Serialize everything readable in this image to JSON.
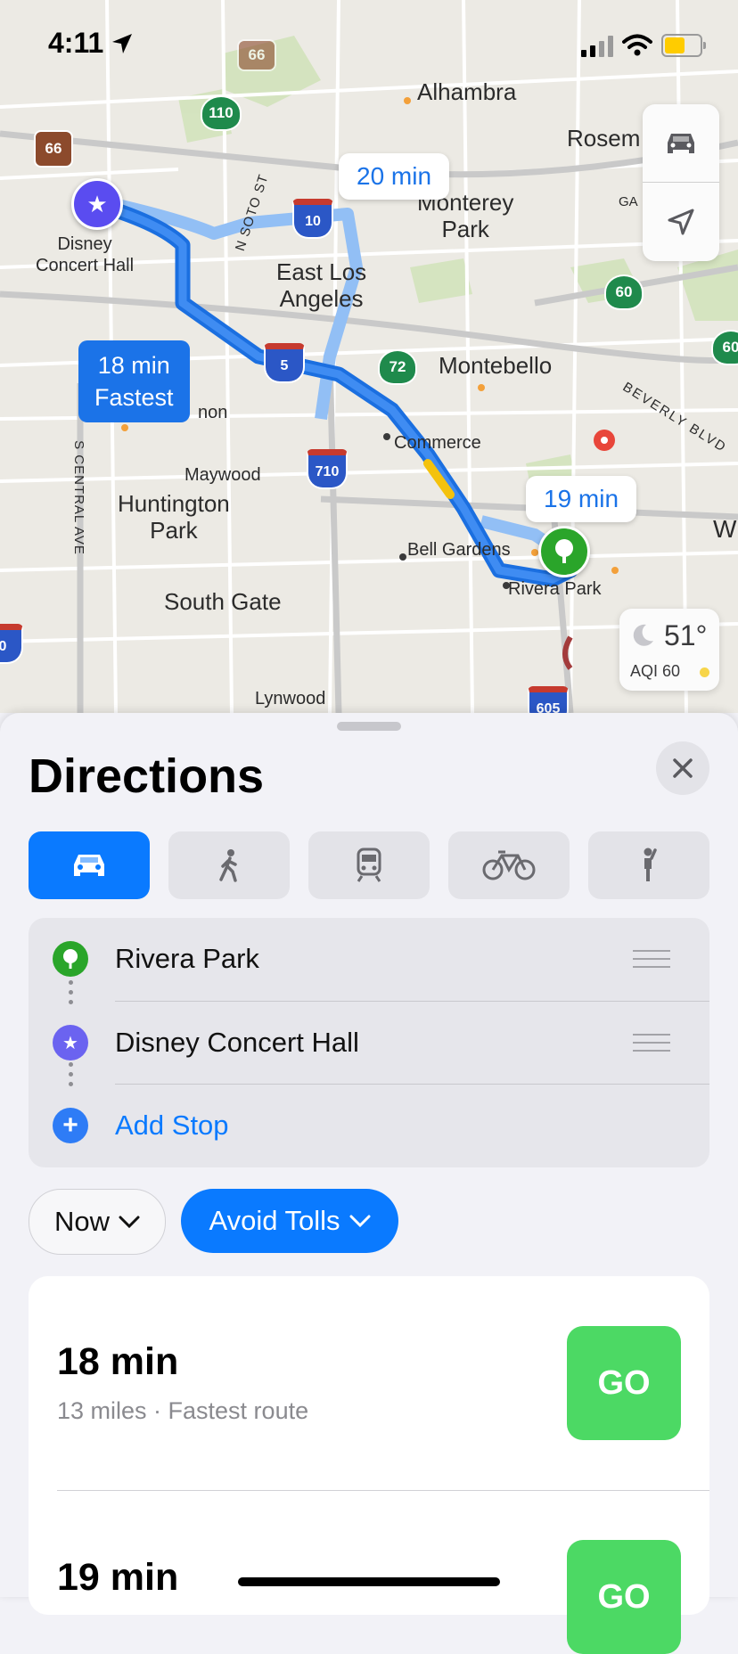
{
  "status_bar": {
    "time": "4:11"
  },
  "map": {
    "places": {
      "alhambra": "Alhambra",
      "rosemead": "Rosem",
      "monterey_park": "Monterey\nPark",
      "east_la": "East Los\nAngeles",
      "montebello": "Montebello",
      "commerce": "Commerce",
      "maywood": "Maywood",
      "huntington_park": "Huntington\nPark",
      "bell_gardens": "Bell Gardens",
      "rivera_park": "Rivera Park",
      "south_gate": "South Gate",
      "lynwood": "Lynwood",
      "disney": "Disney\nConcert Hall",
      "vernon": "non",
      "beverly_blvd": "BEVERLY BLVD",
      "soto_st": "N SOTO ST",
      "central_ave": "S CENTRAL AVE",
      "w_edge": "W",
      "ga_edge": "GA"
    },
    "shields": {
      "us66_a": "66",
      "us66_b": "66",
      "ca110": "110",
      "i10": "10",
      "ca60_a": "60",
      "ca60_b": "60",
      "i5": "5",
      "ca72": "72",
      "i710": "710",
      "i605": "605",
      "edge_0": "0"
    },
    "route_labels": {
      "alt1": "20 min",
      "alt2": "19 min",
      "primary_time": "18 min",
      "primary_tag": "Fastest"
    },
    "weather": {
      "temp": "51°",
      "aqi": "AQI 60"
    }
  },
  "sheet": {
    "title": "Directions",
    "stops": [
      {
        "label": "Rivera Park"
      },
      {
        "label": "Disney Concert Hall"
      }
    ],
    "add_stop": "Add Stop",
    "options": {
      "when": "Now",
      "avoid": "Avoid Tolls"
    },
    "routes": [
      {
        "time": "18 min",
        "detail": "13 miles · Fastest route",
        "go": "GO"
      },
      {
        "time": "19 min",
        "go": "GO"
      }
    ]
  },
  "colors": {
    "accent": "#0a7aff",
    "route": "#1b73e8",
    "go": "#4cd964"
  }
}
